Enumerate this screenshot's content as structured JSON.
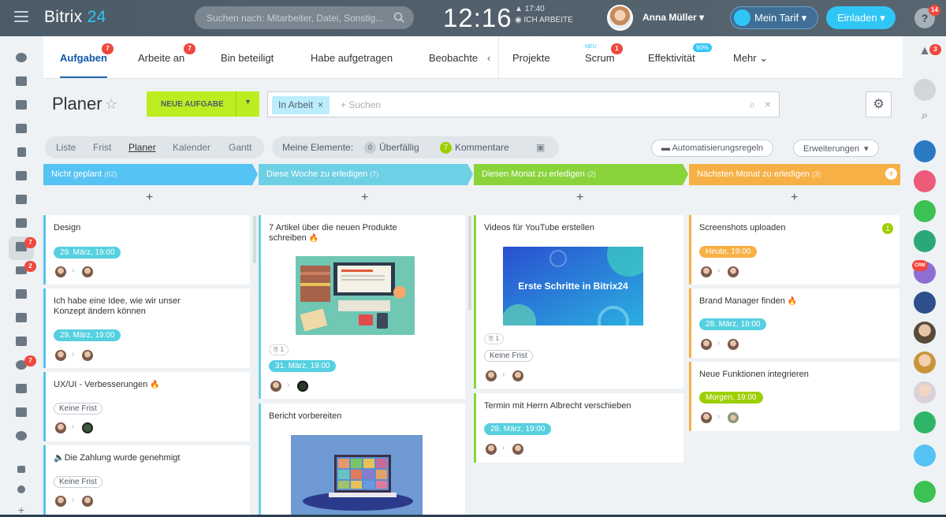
{
  "app": {
    "logo_main": "Bitrix",
    "logo_num": "24",
    "menu_icon": "hamburger-icon"
  },
  "header": {
    "search_placeholder": "Suchen nach: Mitarbeiter, Datei, Sonstig...",
    "clock": "12:16",
    "work_time": "17:40",
    "work_status": "ICH ARBEITE",
    "user_name": "Anna Müller",
    "tarif_label": "Mein Tarif",
    "invite_label": "Einladen",
    "help_badge": "14"
  },
  "tabs": {
    "items": [
      {
        "label": "Aufgaben",
        "badge": "7"
      },
      {
        "label": "Arbeite an",
        "badge": "7"
      },
      {
        "label": "Bin beteiligt"
      },
      {
        "label": "Habe aufgetragen"
      },
      {
        "label": "Beobachte"
      },
      {
        "label": "Projekte"
      },
      {
        "label": "Scrum",
        "badge": "1",
        "tag": "NEU"
      },
      {
        "label": "Effektivität",
        "tag": "90%"
      },
      {
        "label": "Mehr"
      }
    ]
  },
  "toolbar": {
    "title": "Planer",
    "new_task": "NEUE AUFGABE",
    "filter_chip": "In Arbeit",
    "filter_placeholder": "+ Suchen"
  },
  "views": [
    "Liste",
    "Frist",
    "Planer",
    "Kalender",
    "Gantt"
  ],
  "counters": {
    "label": "Meine Elemente:",
    "overdue_count": "0",
    "overdue_label": "Überfällig",
    "comments_count": "7",
    "comments_label": "Kommentare"
  },
  "buttons": {
    "automation": "Automatisierungsregeln",
    "extensions": "Erweiterungen"
  },
  "sidebar_badges": {
    "tasks": "7",
    "filter": "2",
    "sync": "7",
    "bell": "3",
    "crm": "CRM"
  },
  "columns": [
    {
      "title": "Nicht geplant",
      "count": "(62)",
      "color": "#55c3f3"
    },
    {
      "title": "Diese Woche zu erledigen",
      "count": "(7)",
      "color": "#6dd0e4"
    },
    {
      "title": "Diesen Monat zu erledigen",
      "count": "(2)",
      "color": "#89d43b"
    },
    {
      "title": "Nächsten Monat zu erledigen",
      "count": "(3)",
      "color": "#f7b045"
    }
  ],
  "cards": {
    "c1": [
      {
        "title": "Design",
        "date": "29. März, 19:00"
      },
      {
        "title1": "Ich habe eine Idee, wie wir unser",
        "title2": "Konzept ändern können",
        "date": "29. März, 19:00"
      },
      {
        "title": "UX/UI - Verbesserungen",
        "date": "Keine Frist"
      },
      {
        "title": "Die Zahlung wurde genehmigt",
        "date": "Keine Frist"
      }
    ],
    "c2": [
      {
        "title1": "7 Artikel über die neuen Produkte",
        "title2": "schreiben",
        "attach": "1",
        "date": "31. März, 19:00"
      },
      {
        "title": "Bericht vorbereiten"
      }
    ],
    "c3": [
      {
        "title": "Videos für YouTube erstellen",
        "image_text": "Erste Schritte in Bitrix24",
        "attach": "1",
        "date": "Keine Frist"
      },
      {
        "title": "Termin mit Herrn Albrecht verschieben",
        "date": "28. März, 19:00"
      }
    ],
    "c4": [
      {
        "title": "Screenshots uploaden",
        "date": "Heute, 19:00",
        "badge": "1"
      },
      {
        "title": "Brand Manager finden",
        "date": "28. März, 19:00"
      },
      {
        "title": "Neue Funktionen integrieren",
        "date": "Morgen, 19:00"
      }
    ]
  }
}
